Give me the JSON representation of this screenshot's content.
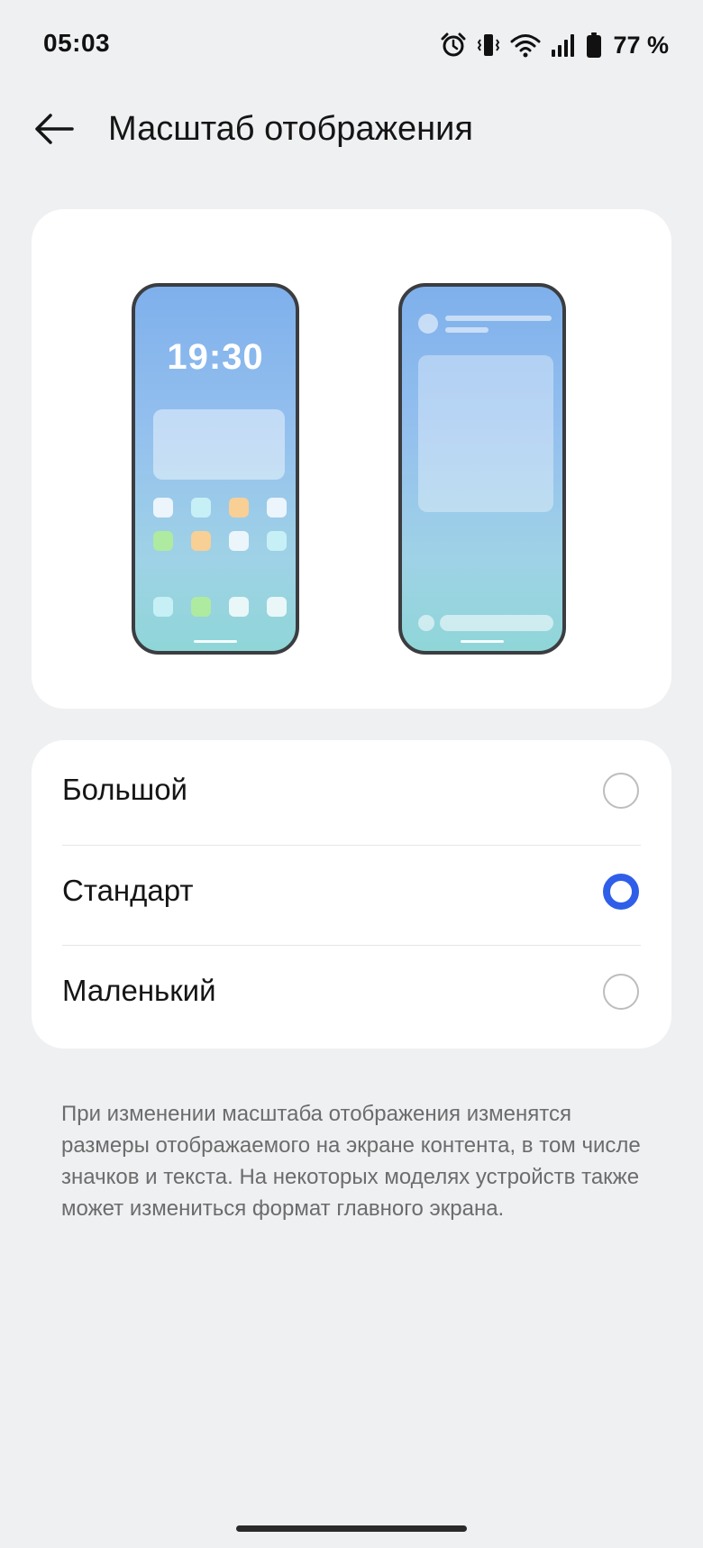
{
  "status_bar": {
    "time": "05:03",
    "battery_percent": "77 %",
    "icons": [
      "alarm-icon",
      "vibrate-icon",
      "wifi-icon",
      "signal-icon",
      "battery-icon"
    ]
  },
  "header": {
    "back_icon": "arrow-left-icon",
    "title": "Масштаб отображения"
  },
  "preview": {
    "left_phone_clock": "19:30"
  },
  "options": [
    {
      "label": "Большой",
      "selected": false
    },
    {
      "label": "Стандарт",
      "selected": true
    },
    {
      "label": "Маленький",
      "selected": false
    }
  ],
  "description": "При изменении масштаба отображения изменятся размеры отображаемого на экране контента, в том числе значков и текста. На некоторых моделях устройств также может измениться формат главного экрана.",
  "colors": {
    "background": "#eff0f2",
    "card": "#ffffff",
    "accent": "#2f5fe8",
    "secondary_text": "#6c6c6c"
  }
}
